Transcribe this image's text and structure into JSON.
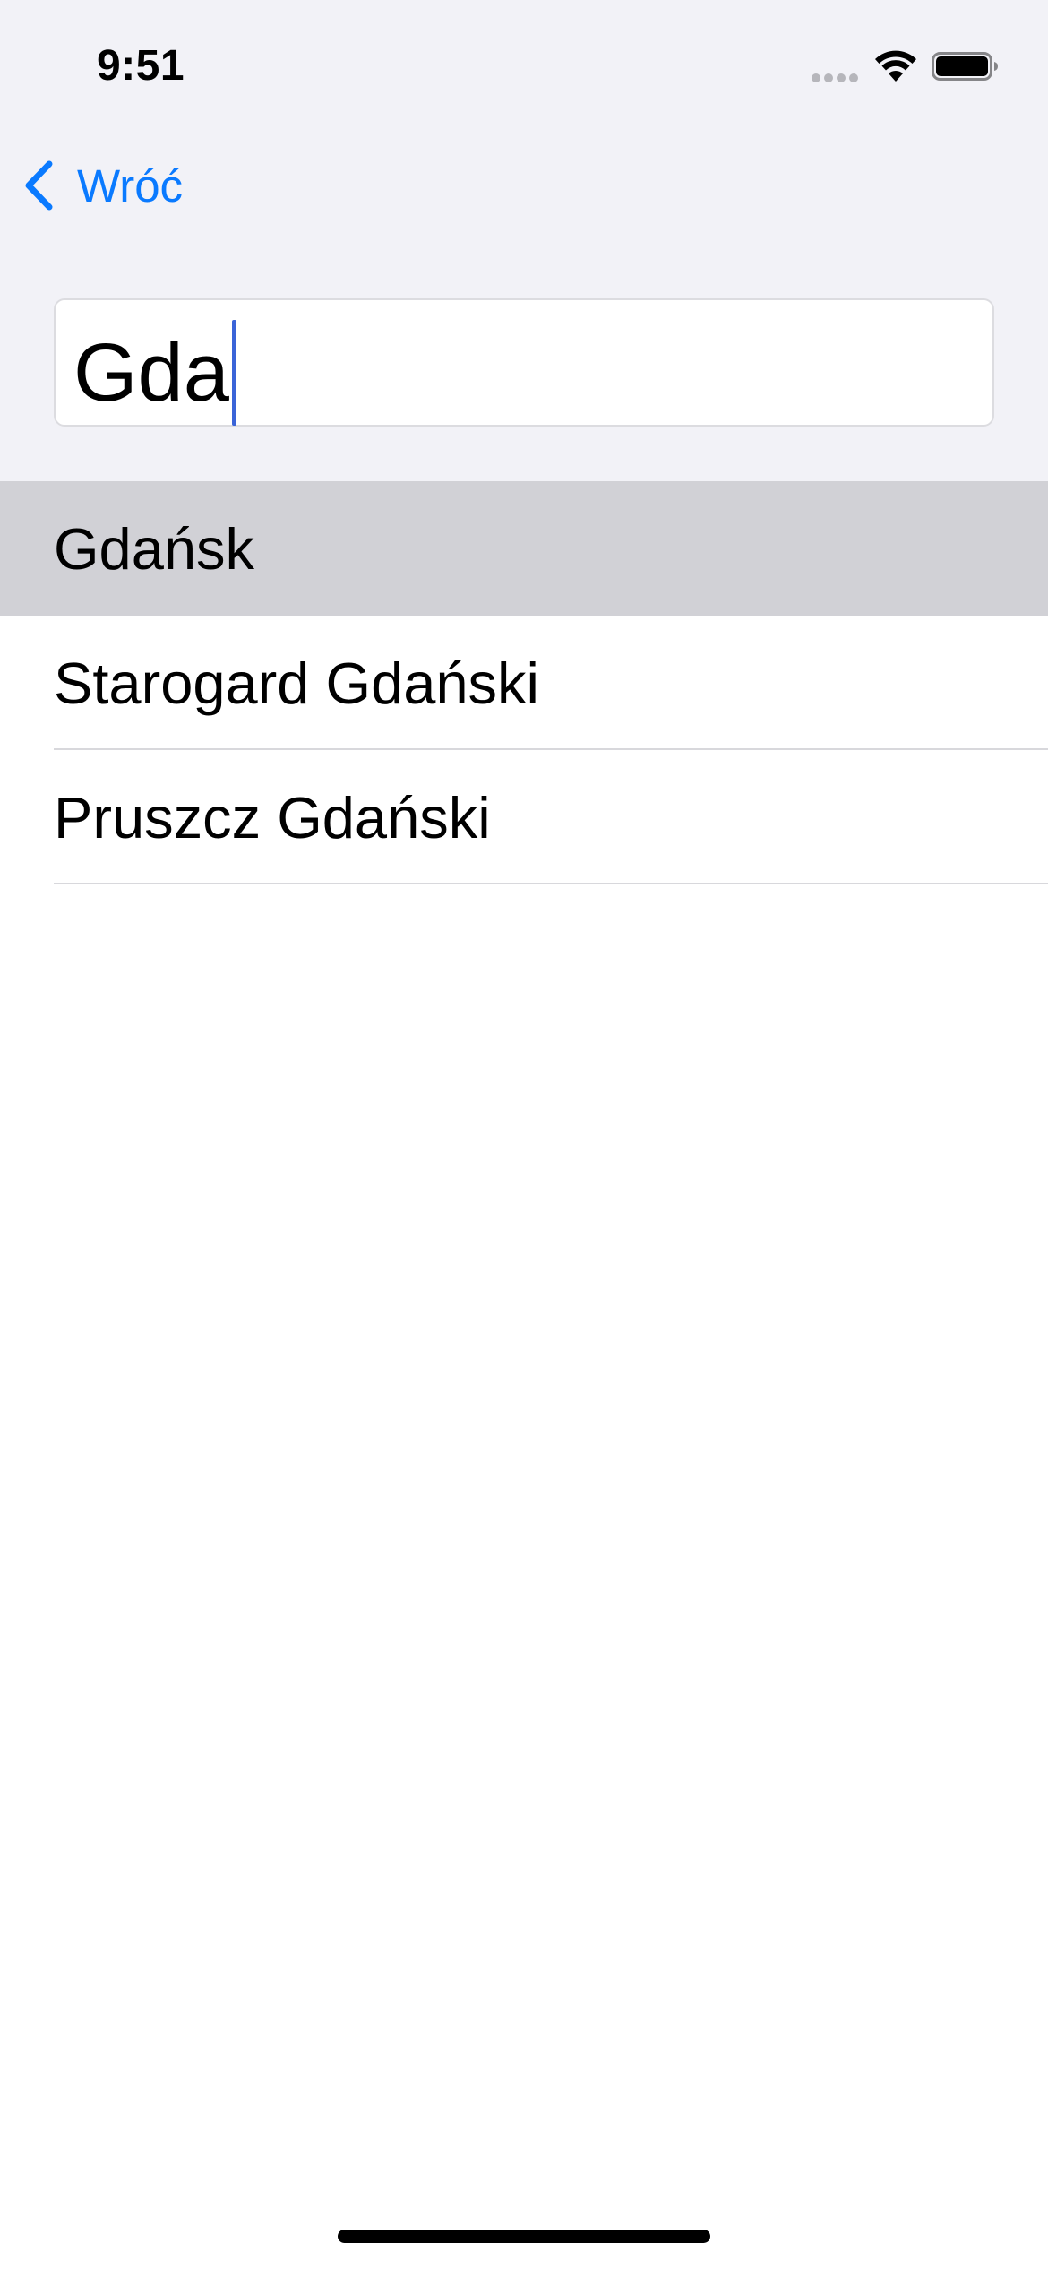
{
  "status_bar": {
    "time": "9:51"
  },
  "nav": {
    "back_label": "Wróć"
  },
  "search": {
    "value": "Gda"
  },
  "results": [
    {
      "label": "Gdańsk",
      "selected": true
    },
    {
      "label": "Starogard Gdański",
      "selected": false
    },
    {
      "label": "Pruszcz Gdański",
      "selected": false
    }
  ],
  "colors": {
    "accent": "#0a7aff",
    "caret": "#3a64d8",
    "grouped_background": "#f2f2f7",
    "selected_row": "#d1d1d6"
  }
}
